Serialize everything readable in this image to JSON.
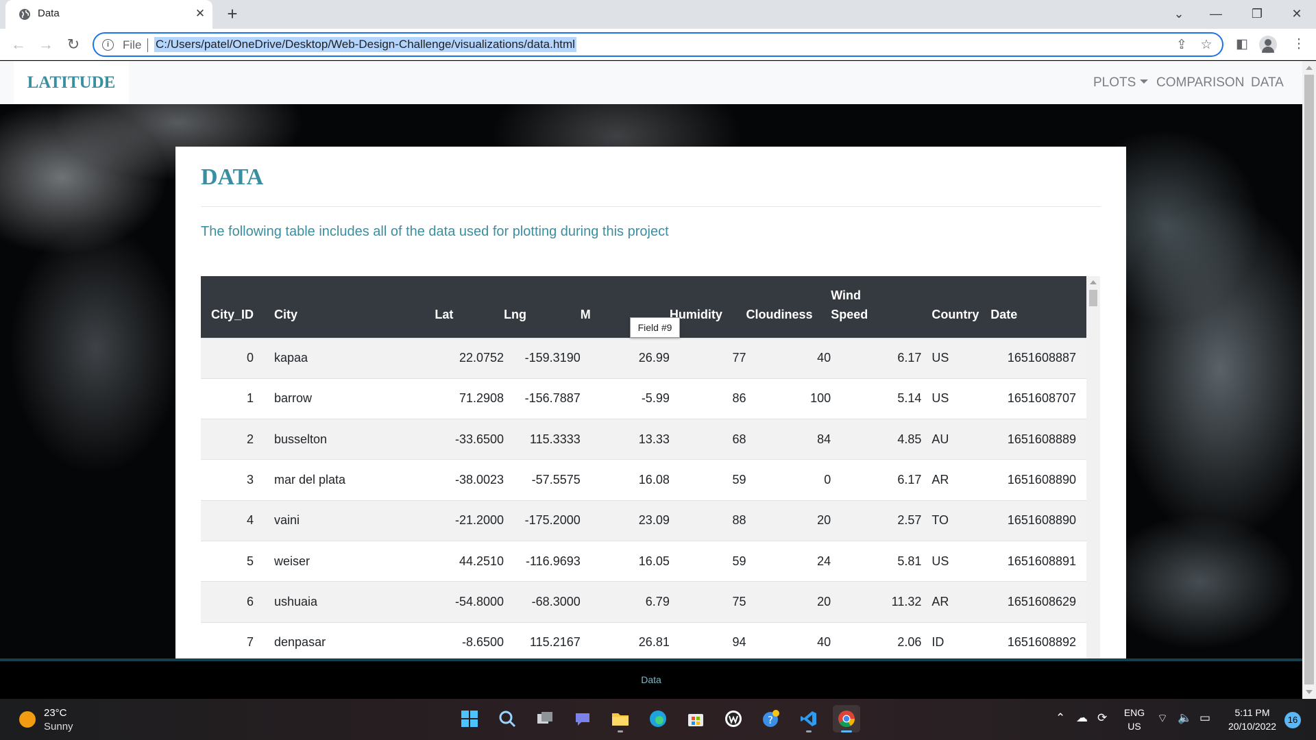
{
  "browser": {
    "tab_title": "Data",
    "new_tab_symbol": "+",
    "close_symbol": "✕",
    "scheme_label": "File",
    "url": "C:/Users/patel/OneDrive/Desktop/Web-Design-Challenge/visualizations/data.html"
  },
  "site": {
    "brand": "LATITUDE",
    "nav": {
      "plots": "PLOTS",
      "comparison": "COMPARISON",
      "data": "DATA"
    }
  },
  "card": {
    "title": "DATA",
    "subtitle": "The following table includes all of the data used for plotting during this project"
  },
  "table": {
    "headers": [
      "City_ID",
      "City",
      "Lat",
      "Lng",
      "Max Temp",
      "Humidity",
      "Cloudiness",
      "Wind Speed",
      "Country",
      "Date"
    ],
    "header_visible": [
      "City_ID",
      "City",
      "Lat",
      "Lng",
      "M",
      "Humidity",
      "Cloudiness",
      "Wind",
      "Country",
      "Date"
    ],
    "header_visible_wind_line2": "Speed",
    "tooltip": "Field #9",
    "rows": [
      [
        "0",
        "kapaa",
        "22.0752",
        "-159.3190",
        "26.99",
        "77",
        "40",
        "6.17",
        "US",
        "1651608887"
      ],
      [
        "1",
        "barrow",
        "71.2908",
        "-156.7887",
        "-5.99",
        "86",
        "100",
        "5.14",
        "US",
        "1651608707"
      ],
      [
        "2",
        "busselton",
        "-33.6500",
        "115.3333",
        "13.33",
        "68",
        "84",
        "4.85",
        "AU",
        "1651608889"
      ],
      [
        "3",
        "mar del plata",
        "-38.0023",
        "-57.5575",
        "16.08",
        "59",
        "0",
        "6.17",
        "AR",
        "1651608890"
      ],
      [
        "4",
        "vaini",
        "-21.2000",
        "-175.2000",
        "23.09",
        "88",
        "20",
        "2.57",
        "TO",
        "1651608890"
      ],
      [
        "5",
        "weiser",
        "44.2510",
        "-116.9693",
        "16.05",
        "59",
        "24",
        "5.81",
        "US",
        "1651608891"
      ],
      [
        "6",
        "ushuaia",
        "-54.8000",
        "-68.3000",
        "6.79",
        "75",
        "20",
        "11.32",
        "AR",
        "1651608629"
      ],
      [
        "7",
        "denpasar",
        "-8.6500",
        "115.2167",
        "26.81",
        "94",
        "40",
        "2.06",
        "ID",
        "1651608892"
      ]
    ]
  },
  "footer": {
    "text": "Data"
  },
  "taskbar": {
    "weather_temp": "23°C",
    "weather_desc": "Sunny",
    "lang_1": "ENG",
    "lang_2": "US",
    "time": "5:11 PM",
    "date": "20/10/2022",
    "notifications": "16",
    "apps": [
      "windows-start",
      "search",
      "task-view",
      "teams-chat",
      "file-explorer",
      "edge",
      "microsoft-store",
      "app-w",
      "help",
      "vscode",
      "chrome"
    ]
  },
  "colors": {
    "accent": "#3a8ea1",
    "table_header": "#343a40",
    "omnibox_focus": "#1a73e8"
  }
}
